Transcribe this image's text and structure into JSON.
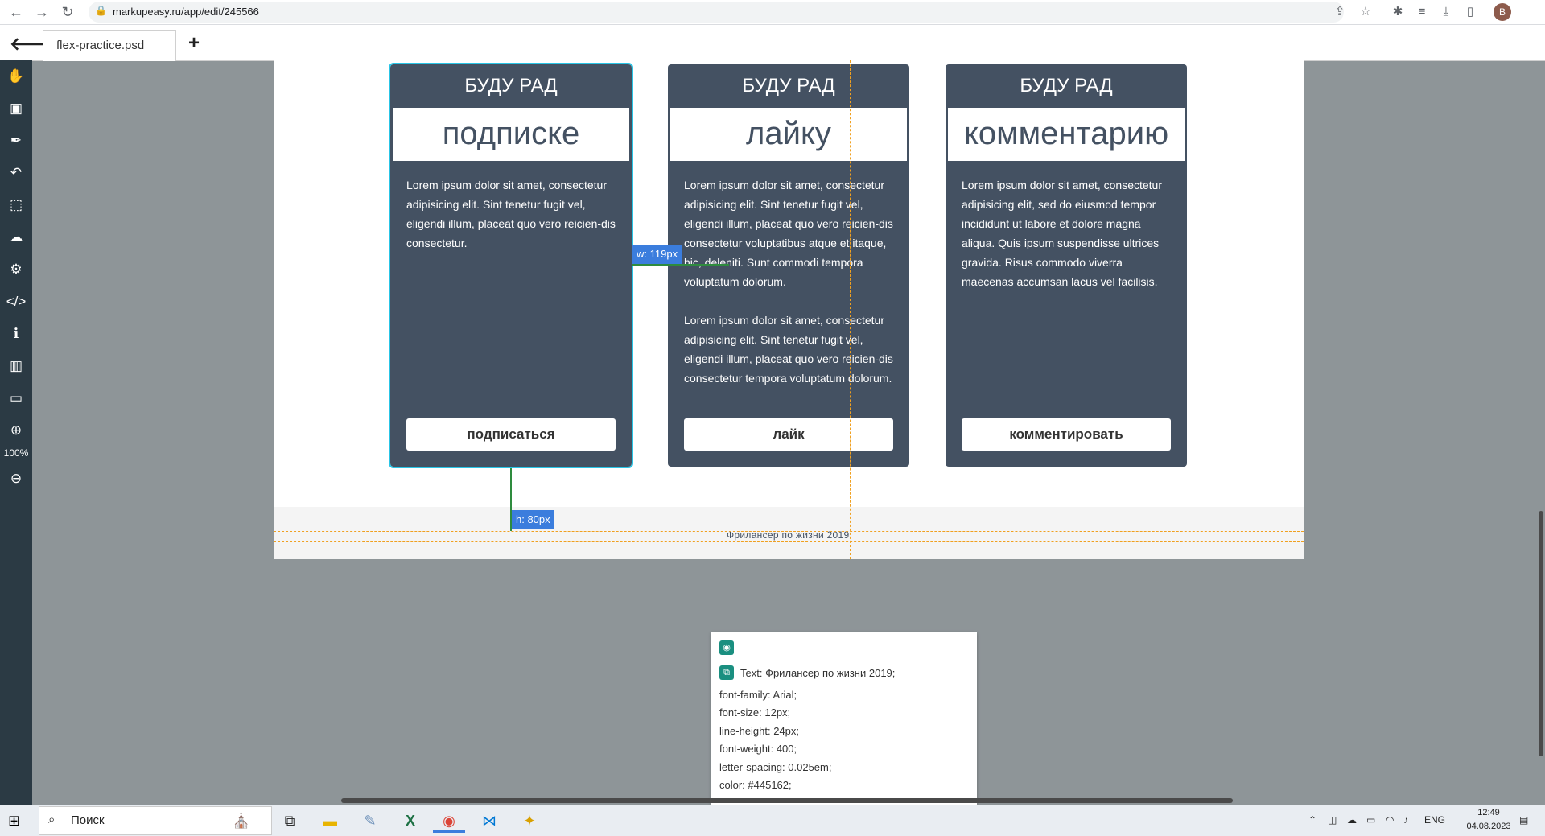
{
  "browser": {
    "url": "markupeasy.ru/app/edit/245566",
    "avatar_letter": "B"
  },
  "app": {
    "tab_title": "flex-practice.psd",
    "zoom": "100%"
  },
  "sidebar": {
    "icons": [
      "hand-icon",
      "frame-icon",
      "eyedropper-icon",
      "undo-icon",
      "crop-icon",
      "cloud-upload-icon",
      "gear-icon",
      "code-icon",
      "info-icon",
      "barcode-icon",
      "money-icon",
      "zoom-in-icon",
      "zoom-out-icon"
    ]
  },
  "cards": [
    {
      "heading": "БУДУ РАД",
      "word": "подписке",
      "paragraphs": [
        "Lorem ipsum dolor sit amet, consectetur adipisicing elit. Sint tenetur fugit vel, eligendi illum, placeat quo vero reicien-dis consectetur."
      ],
      "button": "подписаться"
    },
    {
      "heading": "БУДУ РАД",
      "word": "лайку",
      "paragraphs": [
        "Lorem ipsum dolor sit amet, consectetur adipisicing elit. Sint tenetur fugit vel, eligendi illum, placeat quo vero reicien-dis consectetur voluptatibus atque et itaque, hic, deleniti. Sunt commodi tempora voluptatum dolorum.",
        "Lorem ipsum dolor sit amet, consectetur adipisicing elit. Sint tenetur fugit vel, eligendi illum, placeat quo vero reicien-dis consectetur tempora voluptatum dolorum."
      ],
      "button": "лайк"
    },
    {
      "heading": "БУДУ РАД",
      "word": "комментарию",
      "paragraphs": [
        "Lorem ipsum dolor sit amet, consectetur adipisicing elit, sed do eiusmod tempor incididunt ut labore et dolore magna aliqua. Quis ipsum suspendisse ultrices gravida. Risus commodo viverra maecenas accumsan lacus vel facilisis."
      ],
      "button": "комментировать"
    }
  ],
  "footer": {
    "text": "Фрилансер по жизни 2019"
  },
  "measures": {
    "width": "w: 119px",
    "height": "h: 80px"
  },
  "inspector": {
    "title": "Text: Фрилансер по жизни 2019;",
    "props": [
      "font-family: Arial;",
      "font-size: 12px;",
      "line-height: 24px;",
      "font-weight: 400;",
      "letter-spacing: 0.025em;",
      "color: #445162;"
    ]
  },
  "taskbar": {
    "search_placeholder": "Поиск",
    "language": "ENG",
    "time": "12:49",
    "date": "04.08.2023"
  },
  "colors": {
    "card_bg": "#445162",
    "guide": "#f0a020",
    "measure": "#3b7ddd",
    "canvas_bg": "#8e9598"
  }
}
